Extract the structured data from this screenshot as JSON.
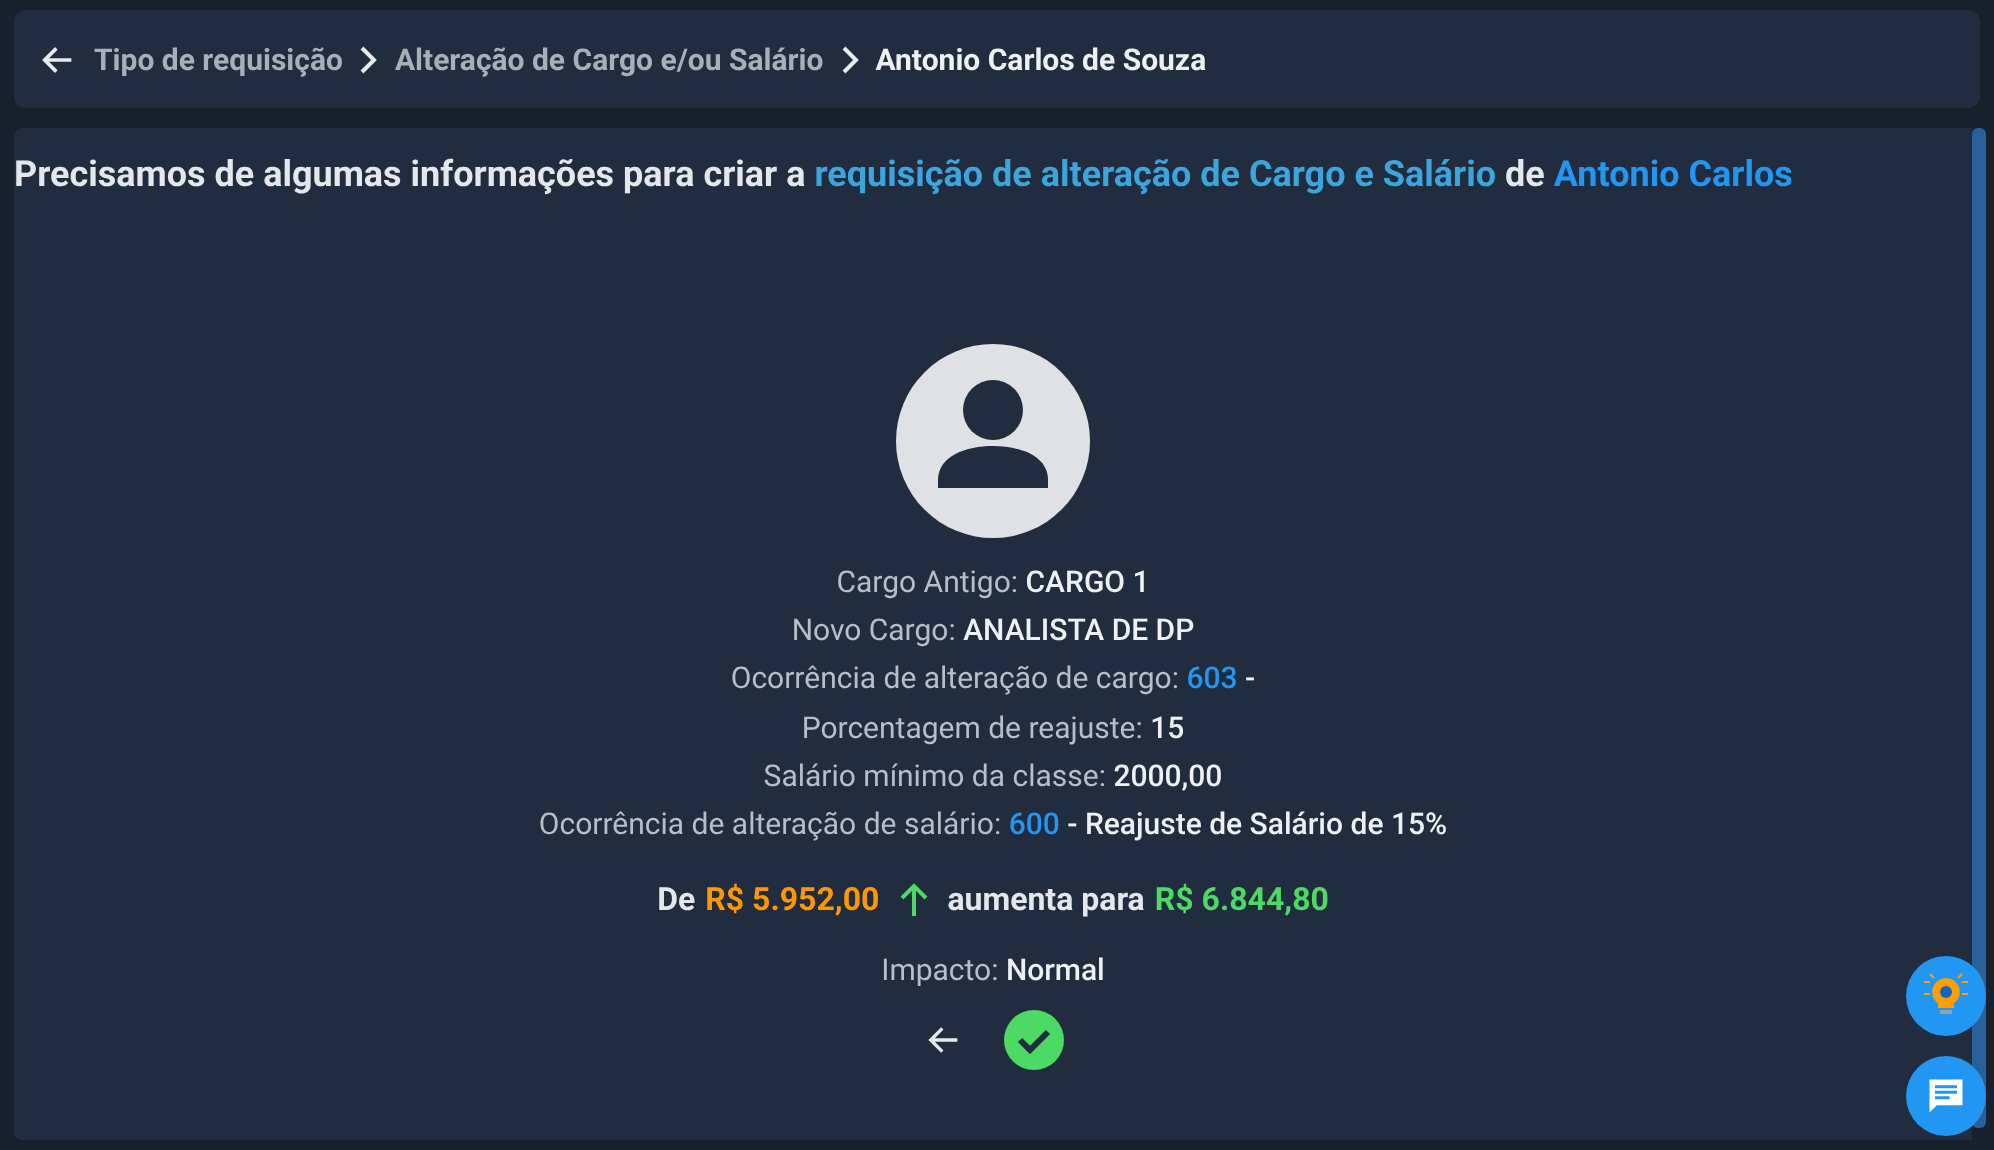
{
  "breadcrumb": [
    {
      "label": "Tipo de requisição",
      "current": false
    },
    {
      "label": "Alteração de Cargo e/ou Salário",
      "current": false
    },
    {
      "label": "Antonio Carlos de Souza",
      "current": true
    }
  ],
  "heading": [
    {
      "text": "Precisamos de algumas informações para criar a ",
      "kind": "plain"
    },
    {
      "text": "requisição de alteração de Cargo e Salário",
      "kind": "highlight"
    },
    {
      "text": " de ",
      "kind": "plain"
    },
    {
      "text": "Antonio Carlos",
      "kind": "name"
    }
  ],
  "details": [
    [
      {
        "text": "Cargo Antigo: ",
        "kind": "label"
      },
      {
        "text": "CARGO 1",
        "kind": "value"
      }
    ],
    [
      {
        "text": "Novo Cargo: ",
        "kind": "label"
      },
      {
        "text": "ANALISTA DE DP",
        "kind": "value"
      }
    ],
    [
      {
        "text": "Ocorrência de alteração de cargo: ",
        "kind": "label"
      },
      {
        "text": "603",
        "kind": "code"
      },
      {
        "text": " -",
        "kind": "value"
      }
    ],
    [
      {
        "text": "Porcentagem de reajuste: ",
        "kind": "label"
      },
      {
        "text": "15",
        "kind": "value"
      }
    ],
    [
      {
        "text": "Salário mínimo da classe: ",
        "kind": "label"
      },
      {
        "text": "2000,00",
        "kind": "value"
      }
    ],
    [
      {
        "text": "Ocorrência de alteração de salário: ",
        "kind": "label"
      },
      {
        "text": "600",
        "kind": "code"
      },
      {
        "text": " - Reajuste de Salário de 15%",
        "kind": "value"
      }
    ]
  ],
  "salary": {
    "from_label": "De",
    "old": "R$ 5.952,00",
    "to_label": "aumenta para",
    "new": "R$ 6.844,80"
  },
  "impact": [
    {
      "text": "Impacto: ",
      "kind": "label"
    },
    {
      "text": "Normal",
      "kind": "value"
    }
  ]
}
